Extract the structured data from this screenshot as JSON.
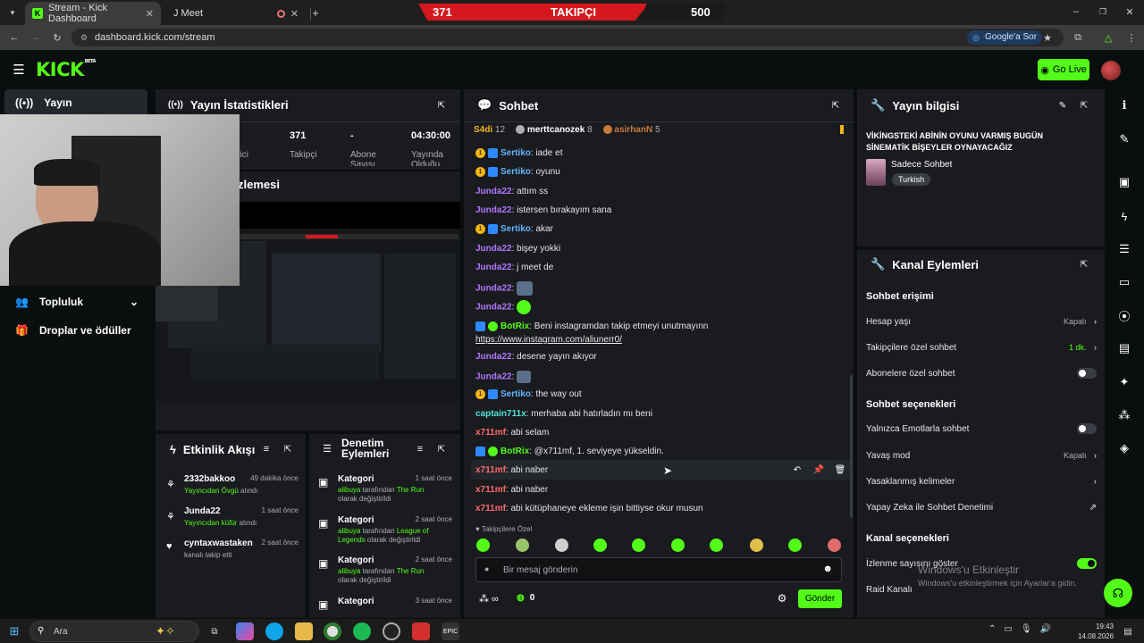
{
  "browser": {
    "tabs": [
      {
        "label": "Stream - Kick Dashboard"
      },
      {
        "label": "J Meet"
      }
    ],
    "url": "dashboard.kick.com/stream",
    "google_btn": "Google'a Sor"
  },
  "banner": {
    "left": "371",
    "center": "TAKIPÇI",
    "right": "500"
  },
  "header": {
    "logo": "KICK",
    "logo_badge": "BETA",
    "go_live": "Go Live"
  },
  "nav": {
    "items": [
      {
        "label": "Yayın"
      },
      {
        "label": "Topluluk"
      },
      {
        "label": "Droplar ve ödüller"
      }
    ]
  },
  "stats": {
    "title": "Yayın İstatistikleri",
    "cells": [
      {
        "value": "",
        "label": "eyici"
      },
      {
        "value": "371",
        "label": "Takipçi"
      },
      {
        "value": "-",
        "label": "Abone Sayısı"
      },
      {
        "value": "04:30:00",
        "label": "Yayında Olduğu"
      }
    ]
  },
  "preview": {
    "title": "zlemesi"
  },
  "activity": {
    "title": "Etkinlik Akışı",
    "items": [
      {
        "name": "2332bakkoo",
        "time": "49 dakika önce",
        "highlight": "Yayıncıdan Övgü",
        "rest": " alındı"
      },
      {
        "name": "Junda22",
        "time": "1 saat önce",
        "highlight": "Yayıncıdan küfür",
        "rest": " alındı"
      },
      {
        "name": "cyntaxwastaken",
        "time": "2 saat önce",
        "highlight": "",
        "rest": "kanalı takip etti"
      }
    ]
  },
  "moderation": {
    "title_line1": "Denetim",
    "title_line2": "Eylemleri",
    "items": [
      {
        "title": "Kategori",
        "time": "1 saat önce",
        "user": "alibuya",
        "mid": " tarafından ",
        "target": "The Run",
        "tail": "olarak değiştirildi"
      },
      {
        "title": "Kategori",
        "time": "2 saat önce",
        "user": "alibuya",
        "mid": " tarafından ",
        "target": "League of Legends",
        "tail": " olarak değiştirildi"
      },
      {
        "title": "Kategori",
        "time": "2 saat önce",
        "user": "alibuya",
        "mid": " tarafından ",
        "target": "The Run",
        "tail": "olarak değiştirildi"
      },
      {
        "title": "Kategori",
        "time": "3 saat önce",
        "user": "",
        "mid": "",
        "target": "",
        "tail": ""
      }
    ]
  },
  "chat": {
    "title": "Sohbet",
    "top_users": [
      {
        "name": "S4di",
        "count": "12"
      },
      {
        "name": "merttcanozek",
        "count": "8"
      },
      {
        "name": "asirhanN",
        "count": "5"
      }
    ],
    "messages": [
      {
        "user": "Sertiko",
        "text": ": iade et"
      },
      {
        "user": "Sertiko",
        "text": ": oyunu"
      },
      {
        "user": "Junda22",
        "text": ": attım ss"
      },
      {
        "user": "Junda22",
        "text": ": istersen bırakayım sana"
      },
      {
        "user": "Sertiko",
        "text": ": akar"
      },
      {
        "user": "Junda22",
        "text": ": bişey yokki"
      },
      {
        "user": "Junda22",
        "text": ": j meet de"
      },
      {
        "user": "Junda22",
        "text": ":"
      },
      {
        "user": "Junda22",
        "text": ":"
      },
      {
        "user": "BotRix",
        "text": ": Beni instagramdan takip etmeyi unutmayınn",
        "link": "https://www.instagram.com/aliunerr0/"
      },
      {
        "user": "Junda22",
        "text": ": desene yayın akıyor"
      },
      {
        "user": "Junda22",
        "text": ":"
      },
      {
        "user": "Sertiko",
        "text": ": the way out"
      },
      {
        "user": "captain711x",
        "text": ": merhaba abi hatırladın mı beni"
      },
      {
        "user": "x711mf",
        "text": ": abi selam"
      },
      {
        "user": "BotRix",
        "text": ": @x711mf, 1. seviyeye yükseldin."
      },
      {
        "user": "x711mf",
        "text": ": abi naber"
      },
      {
        "user": "x711mf",
        "text": ": abi naber"
      },
      {
        "user": "x711mf",
        "text": ": abi kütüphaneye ekleme işin bittiyse okur musun"
      }
    ],
    "mode_label": "Takipçilere Özel",
    "input_placeholder": "Bir mesaj gönderin",
    "points": "0",
    "send": "Gönder"
  },
  "stream_info": {
    "title": "Yayın bilgisi",
    "stream_title": "VİKİNGSTEKİ ABİNİN OYUNU VARMIŞ BUGÜN SİNEMATİK BİŞEYLER OYNAYACAĞIZ",
    "category": "Sadece Sohbet",
    "tag": "Turkish"
  },
  "channel": {
    "title": "Kanal Eylemleri",
    "chat_access": "Sohbet erişimi",
    "account_age": {
      "label": "Hesap yaşı",
      "value": "Kapalı"
    },
    "followers_only": {
      "label": "Takipçilere özel sohbet",
      "value": "1 dk."
    },
    "subs_only": {
      "label": "Abonelere özel sohbet",
      "on": false
    },
    "chat_options": "Sohbet seçenekleri",
    "emote_only": {
      "label": "Yalnızca Emotlarla sohbet",
      "on": false
    },
    "slow_mode": {
      "label": "Yavaş mod",
      "value": "Kapalı"
    },
    "banned_words": {
      "label": "Yasaklanmış kelimeler"
    },
    "ai_moderation": {
      "label": "Yapay Zeka ile Sohbet Denetimi"
    },
    "channel_options": "Kanal seçenekleri",
    "show_viewers": {
      "label": "İzlenme sayısını göster",
      "on": true
    },
    "raid": {
      "label": "Raid Kanalı"
    }
  },
  "watermark": {
    "line1": "Windows'u Etkinleştir",
    "line2": "Windows'u etkinleştirmek için Ayarlar'a gidin."
  },
  "taskbar": {
    "search": "Ara",
    "time": "19:43",
    "date": "14.08.2026"
  },
  "colors": {
    "kick_green": "#53fc18",
    "panel_bg": "#191b1f",
    "page_bg": "#0b0e0f",
    "banner_red": "#d4181d"
  }
}
